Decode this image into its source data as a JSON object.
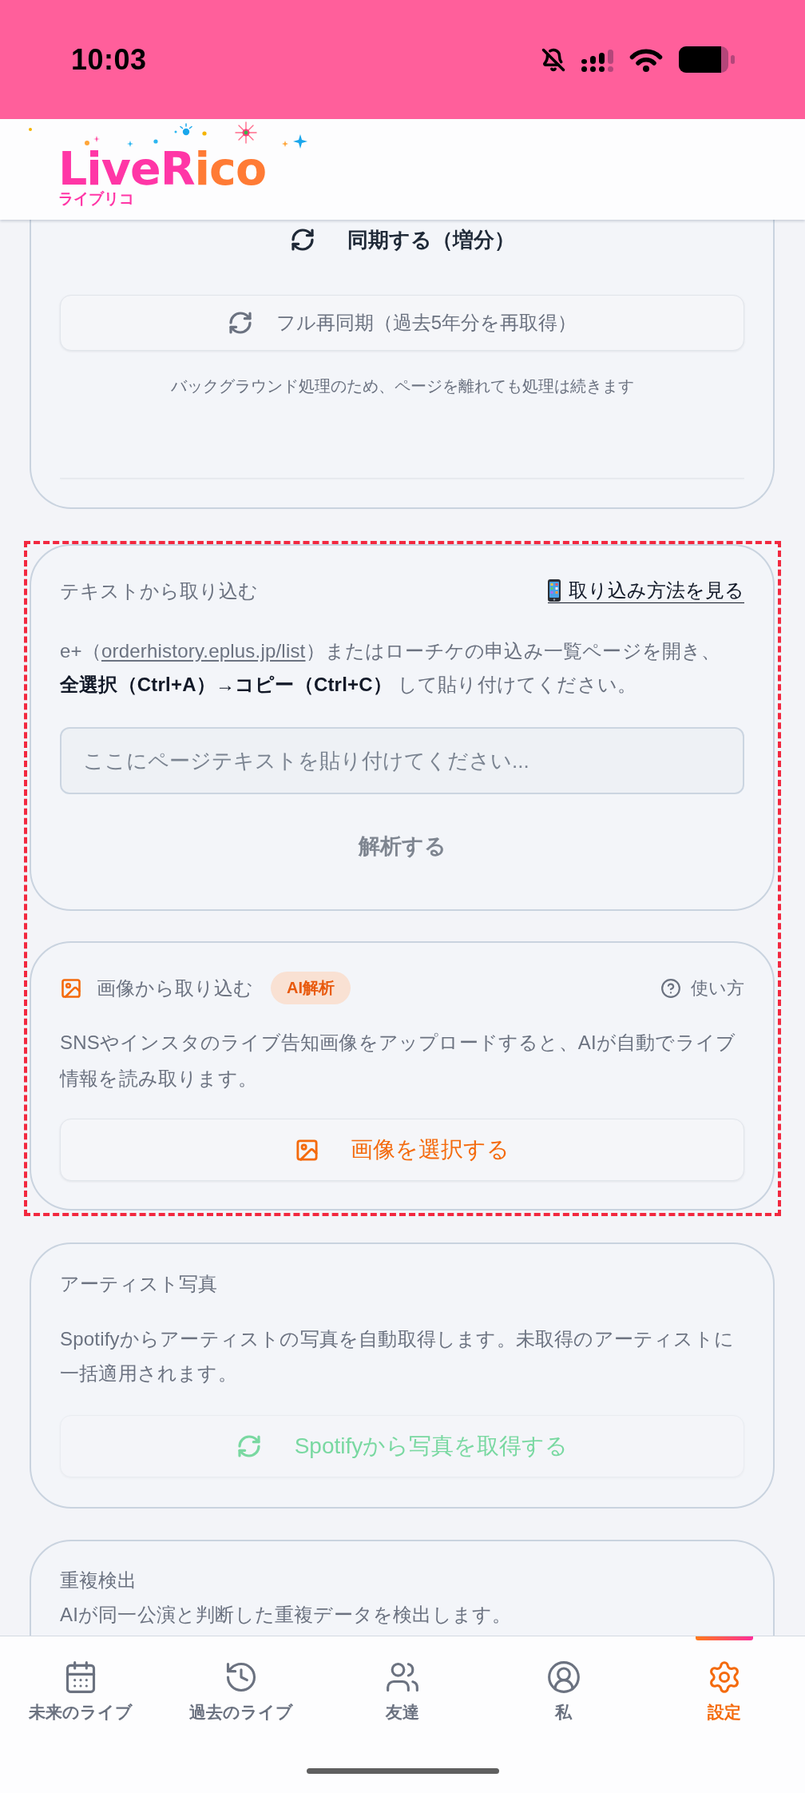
{
  "status_bar": {
    "time": "10:03"
  },
  "header": {
    "logo": {
      "parts": [
        {
          "text": "LiveR",
          "color": "#ff36a6"
        },
        {
          "text": "ico",
          "color": "#ff7b35"
        }
      ],
      "subtitle": "ライブリコ"
    }
  },
  "sync_card": {
    "sync_button": "同期する（増分）",
    "full_resync_button": "フル再同期（過去5年分を再取得）",
    "note": "バックグラウンド処理のため、ページを離れても処理は続きます"
  },
  "text_import": {
    "title": "テキストから取り込む",
    "help_link": "取り込み方法を見る",
    "instructions": {
      "before": "e+（",
      "link": "orderhistory.eplus.jp/list",
      "after": "）またはローチケの申込み一覧ページを開き、**全選択（Ctrl+A）→コピー（Ctrl+C）** して貼り付けてください。"
    },
    "input": {
      "placeholder": "ここにページテキストを貼り付けてください..."
    },
    "parse_button": {
      "label": "解析する",
      "disabled": true
    }
  },
  "image_import": {
    "title": "画像から取り込む",
    "badge": "AI解析",
    "help": "使い方",
    "description": "SNSやインスタのライブ告知画像をアップロードすると、AIが自動でライブ情報を読み取ります。",
    "select_button": "画像を選択する"
  },
  "artist_photos": {
    "title": "アーティスト写真",
    "description": "Spotifyからアーティストの写真を自動取得します。未取得のアーティストに一括適用されます。",
    "fetch_button": {
      "label": "Spotifyから写真を取得する",
      "disabled": true
    }
  },
  "duplicates": {
    "title": "重複検出",
    "description": "AIが同一公演と判断した重複データを検出します。"
  },
  "bottom_nav": [
    {
      "kind": "calendar",
      "label": "未来のライブ",
      "selected": false
    },
    {
      "kind": "history",
      "label": "過去のライブ",
      "selected": false
    },
    {
      "kind": "friends",
      "label": "友達",
      "selected": false
    },
    {
      "kind": "profile",
      "label": "私",
      "selected": false
    },
    {
      "kind": "settings",
      "label": "設定",
      "selected": true
    }
  ]
}
